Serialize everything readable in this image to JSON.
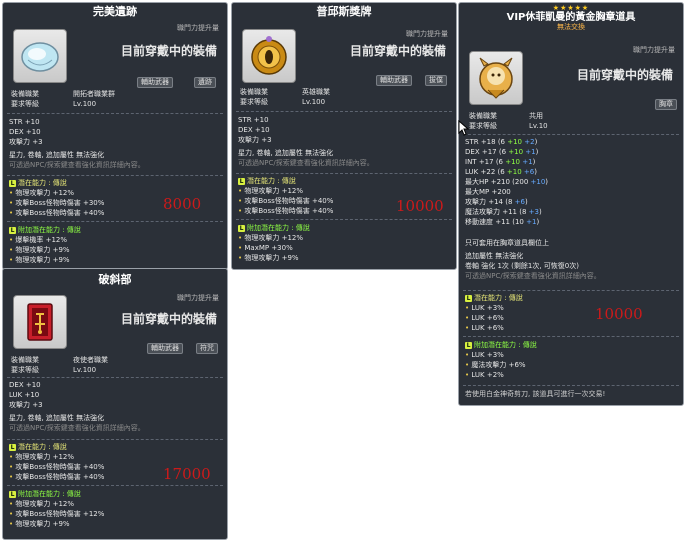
{
  "tooltips": [
    {
      "title": "完美遺跡",
      "damage_label": "職門力提升量",
      "equipped_text": "目前穿戴中的裝備",
      "tags": [
        "輔助武器",
        "遺跡"
      ],
      "job_label": "裝備職業",
      "job_value": "開拓者職業群",
      "level_label": "要求等級",
      "level_value": "Lv.100",
      "stats": [
        "STR  +10",
        "DEX  +10",
        "攻擊力  +3"
      ],
      "flags": "星力, 卷軸, 追加屬性 無法強化",
      "hint": "可透過NPC/探索鍵查看強化資訊詳細內容。",
      "potential_title": "潛在能力 : 傳說",
      "potential": [
        "物理攻擊力 +12%",
        "攻擊Boss怪物時傷害 +30%",
        "攻擊Boss怪物時傷害 +40%"
      ],
      "aux_title": "附加潛在能力 : 傳說",
      "aux": [
        "爆擊機率 +12%",
        "物理攻擊力 +9%",
        "物理攻擊力 +9%"
      ],
      "price": "8000"
    },
    {
      "title": "普邱斯獎牌",
      "damage_label": "職門力提升量",
      "equipped_text": "目前穿戴中的裝備",
      "tags": [
        "輔助武器",
        "拔僕"
      ],
      "job_label": "裝備職業",
      "job_value": "英雄職業",
      "level_label": "要求等級",
      "level_value": "Lv.100",
      "stats": [
        "STR  +10",
        "DEX  +10",
        "攻擊力  +3"
      ],
      "flags": "星力, 卷軸, 追加屬性 無法強化",
      "hint": "可透過NPC/探索鍵查看強化資訊詳細內容。",
      "potential_title": "潛在能力 : 傳說",
      "potential": [
        "物理攻擊力 +12%",
        "攻擊Boss怪物時傷害 +40%",
        "攻擊Boss怪物時傷害 +40%"
      ],
      "aux_title": "附加潛在能力 : 傳說",
      "aux": [
        "物理攻擊力 +12%",
        "MaxMP +30%",
        "物理攻擊力 +9%"
      ],
      "price": "10000"
    },
    {
      "title": "破斜部",
      "damage_label": "職門力提升量",
      "equipped_text": "目前穿戴中的裝備",
      "tags": [
        "輔助武器",
        "符咒"
      ],
      "job_label": "裝備職業",
      "job_value": "夜使者職業",
      "level_label": "要求等級",
      "level_value": "Lv.100",
      "stats": [
        "DEX  +10",
        "LUK  +10",
        "攻擊力  +3"
      ],
      "flags": "星力, 卷軸, 追加屬性 無法強化",
      "hint": "可透過NPC/探索鍵查看強化資訊詳細內容。",
      "potential_title": "潛在能力 : 傳說",
      "potential": [
        "物理攻擊力 +12%",
        "攻擊Boss怪物時傷害 +40%",
        "攻擊Boss怪物時傷害 +40%"
      ],
      "aux_title": "附加潛在能力 : 傳說",
      "aux": [
        "物理攻擊力 +12%",
        "攻擊Boss怪物時傷害 +12%",
        "物理攻擊力 +9%"
      ],
      "price": "17000"
    },
    {
      "stars": "★★★★★",
      "title": "VIP休菲凱曼的黃金胸章道具",
      "subtitle": "無法交換",
      "damage_label": "職門力提升量",
      "equipped_text": "目前穿戴中的裝備",
      "tags": [
        "胸章"
      ],
      "job_label": "裝備職業",
      "job_value": "共用",
      "level_label": "要求等級",
      "level_value": "Lv.10",
      "stats": [
        {
          "name": "STR",
          "total": "+18",
          "base": "6",
          "g": "+10",
          "b": "+2"
        },
        {
          "name": "DEX",
          "total": "+17",
          "base": "6",
          "g": "+10",
          "b": "+1"
        },
        {
          "name": "INT",
          "total": "+17",
          "base": "6",
          "g": "+10",
          "b": "+1"
        },
        {
          "name": "LUK",
          "total": "+22",
          "base": "6",
          "g": "+10",
          "b": "+6"
        },
        {
          "name": "最大HP",
          "total": "+210",
          "base": "200",
          "g": "",
          "b": "+10"
        },
        {
          "name": "最大MP",
          "total": "+200",
          "base": "",
          "g": "",
          "b": ""
        },
        {
          "name": "攻擊力",
          "total": "+14",
          "base": "8",
          "g": "",
          "b": "+6"
        },
        {
          "name": "魔法攻擊力",
          "total": "+11",
          "base": "8",
          "g": "",
          "b": "+3"
        },
        {
          "name": "移動速度",
          "total": "+11",
          "base": "10",
          "g": "",
          "b": "+1"
        }
      ],
      "note": "只可套用在胸章道具欄位上",
      "flags": "追加屬性 無法強化",
      "scroll": "卷軸 強化 1次 (剩餘1次, 可恢復0次)",
      "hint": "可透過NPC/探索鍵查看強化資訊詳細內容。",
      "potential_title": "潛在能力 : 傳說",
      "potential": [
        "LUK +3%",
        "LUK +6%",
        "LUK +6%"
      ],
      "aux_title": "附加潛在能力 : 傳說",
      "aux": [
        "LUK +3%",
        "魔法攻擊力 +6%",
        "LUK +2%"
      ],
      "footer": "若使用白金神奇剪刀, 該道具可進行一次交易!",
      "price": "10000"
    }
  ]
}
